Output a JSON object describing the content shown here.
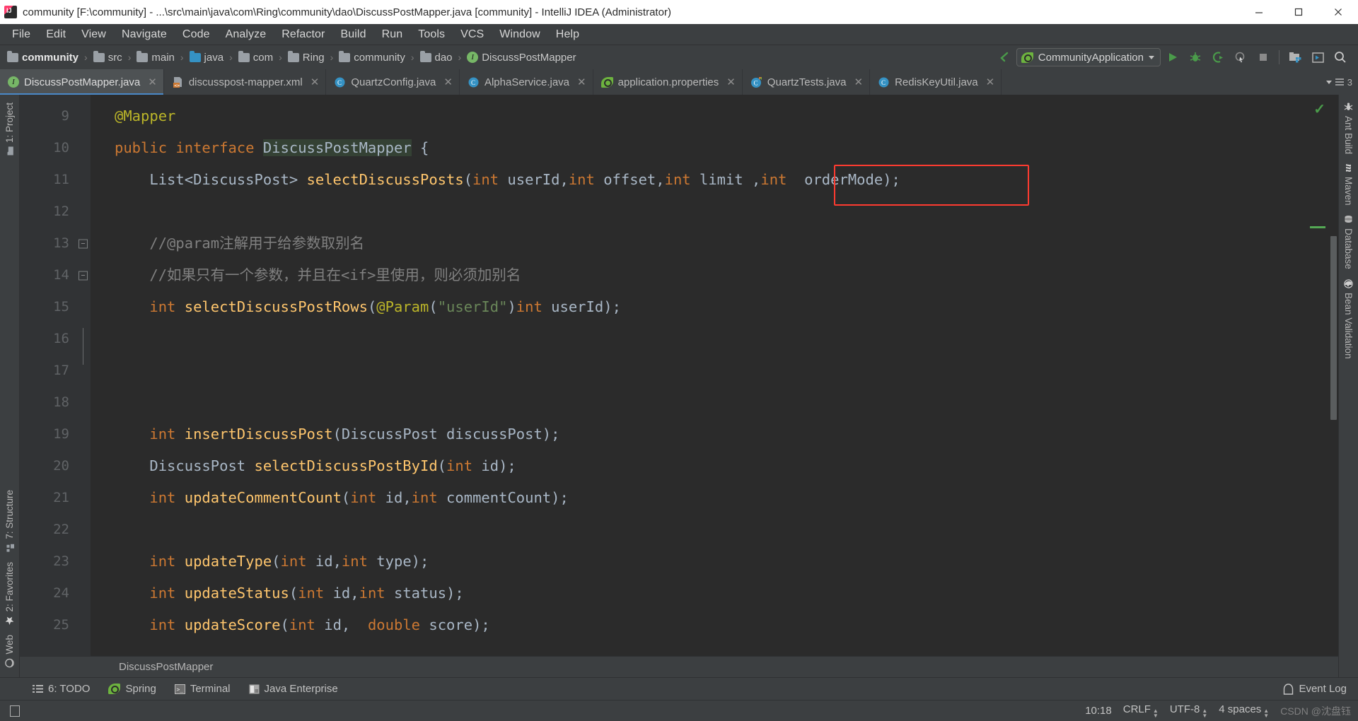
{
  "window": {
    "title": "community [F:\\community] - ...\\src\\main\\java\\com\\Ring\\community\\dao\\DiscussPostMapper.java [community] - IntelliJ IDEA (Administrator)",
    "minimize_label": "—",
    "maximize_label": "❐",
    "close_label": "✕"
  },
  "menu": {
    "items": [
      {
        "label": "File"
      },
      {
        "label": "Edit"
      },
      {
        "label": "View"
      },
      {
        "label": "Navigate"
      },
      {
        "label": "Code"
      },
      {
        "label": "Analyze"
      },
      {
        "label": "Refactor"
      },
      {
        "label": "Build"
      },
      {
        "label": "Run"
      },
      {
        "label": "Tools"
      },
      {
        "label": "VCS"
      },
      {
        "label": "Window"
      },
      {
        "label": "Help"
      }
    ]
  },
  "navbar": {
    "breadcrumb": [
      {
        "label": "community",
        "icon": "folder-icon",
        "bold": true,
        "color": "grey"
      },
      {
        "label": "src",
        "icon": "folder-icon",
        "bold": false,
        "color": "grey"
      },
      {
        "label": "main",
        "icon": "folder-icon",
        "bold": false,
        "color": "grey"
      },
      {
        "label": "java",
        "icon": "folder-icon",
        "bold": false,
        "color": "blue"
      },
      {
        "label": "com",
        "icon": "folder-icon",
        "bold": false,
        "color": "grey"
      },
      {
        "label": "Ring",
        "icon": "folder-icon",
        "bold": false,
        "color": "grey"
      },
      {
        "label": "community",
        "icon": "folder-icon",
        "bold": false,
        "color": "grey"
      },
      {
        "label": "dao",
        "icon": "folder-icon",
        "bold": false,
        "color": "grey"
      },
      {
        "label": "DiscussPostMapper",
        "icon": "interface-icon",
        "bold": false,
        "color": "green"
      }
    ],
    "separator": "›",
    "run_config": "CommunityApplication",
    "buttons": [
      {
        "name": "back-arrow-icon"
      },
      {
        "name": "run-button"
      },
      {
        "name": "debug-button"
      },
      {
        "name": "run-with-coverage-button"
      },
      {
        "name": "profile-button"
      },
      {
        "name": "stop-button"
      },
      {
        "name": "project-structure-button"
      },
      {
        "name": "show-in-window-button"
      },
      {
        "name": "search-everywhere-button"
      }
    ]
  },
  "tabs": {
    "items": [
      {
        "label": "DiscussPostMapper.java",
        "icon": "interface-icon",
        "active": true,
        "close": "✕"
      },
      {
        "label": "discusspost-mapper.xml",
        "icon": "xml-file-icon",
        "active": false,
        "close": "✕"
      },
      {
        "label": "QuartzConfig.java",
        "icon": "class-icon",
        "active": false,
        "close": "✕"
      },
      {
        "label": "AlphaService.java",
        "icon": "class-icon",
        "active": false,
        "close": "✕"
      },
      {
        "label": "application.properties",
        "icon": "spring-icon",
        "active": false,
        "close": "✕"
      },
      {
        "label": "QuartzTests.java",
        "icon": "test-class-icon",
        "active": false,
        "close": "✕"
      },
      {
        "label": "RedisKeyUtil.java",
        "icon": "class-icon",
        "active": false,
        "close": "✕"
      }
    ],
    "overflow_count": "3"
  },
  "left_sidebar": {
    "items": [
      {
        "label": "1: Project",
        "icon": "project-folder-icon"
      },
      {
        "label": "7: Structure",
        "icon": "structure-icon"
      },
      {
        "label": "2: Favorites",
        "icon": "star-icon"
      },
      {
        "label": "Web",
        "icon": "web-icon"
      }
    ]
  },
  "right_sidebar": {
    "items": [
      {
        "label": "Ant Build",
        "icon": "ant-icon"
      },
      {
        "label": "Maven",
        "icon": "maven-icon"
      },
      {
        "label": "Database",
        "icon": "database-icon"
      },
      {
        "label": "Bean Validation",
        "icon": "bean-icon"
      }
    ]
  },
  "editor": {
    "first_line_number": 9,
    "lines": [
      {
        "n": "9",
        "fold": "",
        "tokens": [
          {
            "t": "@Mapper",
            "c": "an",
            "indent": 0
          }
        ]
      },
      {
        "n": "10",
        "fold": "",
        "tokens": [
          {
            "t": "public interface ",
            "c": "kw"
          },
          {
            "t": "DiscussPostMapper",
            "c": "ty hl-ident"
          },
          {
            "t": " {",
            "c": "pl"
          }
        ]
      },
      {
        "n": "11",
        "fold": "",
        "tokens": [
          {
            "t": "    List<DiscussPost> ",
            "c": "ty"
          },
          {
            "t": "selectDiscussPosts",
            "c": "fn"
          },
          {
            "t": "(",
            "c": "pl"
          },
          {
            "t": "int",
            "c": "kw"
          },
          {
            "t": " userId",
            "c": "pl"
          },
          {
            "t": ",",
            "c": "pl"
          },
          {
            "t": "int",
            "c": "kw"
          },
          {
            "t": " offset",
            "c": "pl"
          },
          {
            "t": ",",
            "c": "pl"
          },
          {
            "t": "int",
            "c": "kw"
          },
          {
            "t": " limit",
            "c": "pl"
          },
          {
            "t": " ,",
            "c": "pl"
          },
          {
            "t": "int",
            "c": "kw"
          },
          {
            "t": "  orderMode",
            "c": "ty"
          },
          {
            "t": ")",
            "c": "pl"
          },
          {
            "t": ";",
            "c": "pl"
          }
        ]
      },
      {
        "n": "12",
        "fold": "",
        "tokens": []
      },
      {
        "n": "13",
        "fold": "start",
        "tokens": [
          {
            "t": "    //@param注解用于给参数取别名",
            "c": "cm"
          }
        ]
      },
      {
        "n": "14",
        "fold": "end",
        "tokens": [
          {
            "t": "    //如果只有一个参数，并且在<if>里使用，则必须加别名",
            "c": "cm"
          }
        ]
      },
      {
        "n": "15",
        "fold": "",
        "tokens": [
          {
            "t": "    int",
            "c": "kw"
          },
          {
            "t": " ",
            "c": "pl"
          },
          {
            "t": "selectDiscussPostRows",
            "c": "fn"
          },
          {
            "t": "(",
            "c": "pl"
          },
          {
            "t": "@Param",
            "c": "an"
          },
          {
            "t": "(",
            "c": "pl"
          },
          {
            "t": "\"userId\"",
            "c": "st"
          },
          {
            "t": ")",
            "c": "pl"
          },
          {
            "t": "int",
            "c": "kw"
          },
          {
            "t": " userId",
            "c": "pl"
          },
          {
            "t": ")",
            "c": "pl"
          },
          {
            "t": ";",
            "c": "pl"
          }
        ]
      },
      {
        "n": "16",
        "fold": "",
        "tokens": []
      },
      {
        "n": "17",
        "fold": "",
        "tokens": []
      },
      {
        "n": "18",
        "fold": "",
        "tokens": []
      },
      {
        "n": "19",
        "fold": "",
        "tokens": [
          {
            "t": "    int",
            "c": "kw"
          },
          {
            "t": " ",
            "c": "pl"
          },
          {
            "t": "insertDiscussPost",
            "c": "fn"
          },
          {
            "t": "(",
            "c": "pl"
          },
          {
            "t": "DiscussPost",
            "c": "ty"
          },
          {
            "t": " discussPost",
            "c": "pl"
          },
          {
            "t": ")",
            "c": "pl"
          },
          {
            "t": ";",
            "c": "pl"
          }
        ]
      },
      {
        "n": "20",
        "fold": "",
        "tokens": [
          {
            "t": "    DiscussPost",
            "c": "ty"
          },
          {
            "t": " ",
            "c": "pl"
          },
          {
            "t": "selectDiscussPostById",
            "c": "fn"
          },
          {
            "t": "(",
            "c": "pl"
          },
          {
            "t": "int",
            "c": "kw"
          },
          {
            "t": " id",
            "c": "pl"
          },
          {
            "t": ")",
            "c": "pl"
          },
          {
            "t": ";",
            "c": "pl"
          }
        ]
      },
      {
        "n": "21",
        "fold": "",
        "tokens": [
          {
            "t": "    int",
            "c": "kw"
          },
          {
            "t": " ",
            "c": "pl"
          },
          {
            "t": "updateCommentCount",
            "c": "fn"
          },
          {
            "t": "(",
            "c": "pl"
          },
          {
            "t": "int",
            "c": "kw"
          },
          {
            "t": " id",
            "c": "pl"
          },
          {
            "t": ",",
            "c": "pl"
          },
          {
            "t": "int",
            "c": "kw"
          },
          {
            "t": " commentCount",
            "c": "pl"
          },
          {
            "t": ")",
            "c": "pl"
          },
          {
            "t": ";",
            "c": "pl"
          }
        ]
      },
      {
        "n": "22",
        "fold": "",
        "tokens": []
      },
      {
        "n": "23",
        "fold": "",
        "tokens": [
          {
            "t": "    int",
            "c": "kw"
          },
          {
            "t": " ",
            "c": "pl"
          },
          {
            "t": "updateType",
            "c": "fn"
          },
          {
            "t": "(",
            "c": "pl"
          },
          {
            "t": "int",
            "c": "kw"
          },
          {
            "t": " id",
            "c": "pl"
          },
          {
            "t": ",",
            "c": "pl"
          },
          {
            "t": "int",
            "c": "kw"
          },
          {
            "t": " type",
            "c": "pl"
          },
          {
            "t": ")",
            "c": "pl"
          },
          {
            "t": ";",
            "c": "pl"
          }
        ]
      },
      {
        "n": "24",
        "fold": "",
        "tokens": [
          {
            "t": "    int",
            "c": "kw"
          },
          {
            "t": " ",
            "c": "pl"
          },
          {
            "t": "updateStatus",
            "c": "fn"
          },
          {
            "t": "(",
            "c": "pl"
          },
          {
            "t": "int",
            "c": "kw"
          },
          {
            "t": " id",
            "c": "pl"
          },
          {
            "t": ",",
            "c": "pl"
          },
          {
            "t": "int",
            "c": "kw"
          },
          {
            "t": " status",
            "c": "pl"
          },
          {
            "t": ")",
            "c": "pl"
          },
          {
            "t": ";",
            "c": "pl"
          }
        ]
      },
      {
        "n": "25",
        "fold": "",
        "tokens": [
          {
            "t": "    int",
            "c": "kw"
          },
          {
            "t": " ",
            "c": "pl"
          },
          {
            "t": "updateScore",
            "c": "fn"
          },
          {
            "t": "(",
            "c": "pl"
          },
          {
            "t": "int",
            "c": "kw"
          },
          {
            "t": " id",
            "c": "pl"
          },
          {
            "t": ",  ",
            "c": "pl"
          },
          {
            "t": "double",
            "c": "kw"
          },
          {
            "t": " score",
            "c": "pl"
          },
          {
            "t": ")",
            "c": "pl"
          },
          {
            "t": ";",
            "c": "pl"
          }
        ]
      }
    ],
    "highlight_box": {
      "color": "#ff3b30",
      "note": "selection box around ', int  orderMode);'"
    },
    "bottom_breadcrumb": "DiscussPostMapper"
  },
  "tool_window_bar": {
    "items": [
      {
        "label": "6: TODO",
        "icon": "todo-list-icon"
      },
      {
        "label": "Spring",
        "icon": "spring-icon"
      },
      {
        "label": "Terminal",
        "icon": "terminal-icon"
      },
      {
        "label": "Java Enterprise",
        "icon": "java-enterprise-icon"
      }
    ],
    "event_log": "Event Log"
  },
  "status_bar": {
    "position": "10:18",
    "line_separator": "CRLF",
    "encoding": "UTF-8",
    "indent": "4 spaces",
    "watermark": "CSDN @沈盘钰"
  },
  "colors": {
    "accent": "#4a88c7",
    "background": "#3c3f41",
    "editor_background": "#2b2b2b",
    "keyword": "#cc7832",
    "method": "#ffc66d",
    "string": "#6a8759",
    "annotation": "#bbb529",
    "comment": "#808080",
    "identifier": "#a9b7c6",
    "highlight_box": "#ff3b30"
  }
}
